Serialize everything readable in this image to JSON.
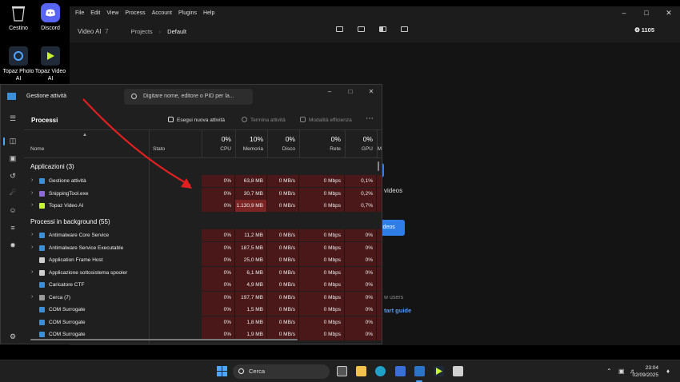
{
  "desktop": {
    "icons": [
      {
        "label": "Cestino",
        "icon": "recycle-bin-icon"
      },
      {
        "label": "Discord",
        "icon": "discord-icon"
      },
      {
        "label": "Topaz Photo AI",
        "icon": "topaz-photo-icon"
      },
      {
        "label": "Topaz Video AI",
        "icon": "topaz-video-icon"
      }
    ]
  },
  "video_ai": {
    "menu": [
      "File",
      "Edit",
      "View",
      "Process",
      "Account",
      "Plugins",
      "Help"
    ],
    "brand": "Video AI",
    "version": "7",
    "breadcrumb": [
      "Projects",
      "Default"
    ],
    "credits": "1105",
    "peek": {
      "line1": "videos",
      "button": "ideos",
      "line2": "w users",
      "link": "tart guide"
    },
    "accent": "#2f7ee8"
  },
  "task_manager": {
    "title": "Gestione attività",
    "search_placeholder": "Digitare nome, editore o PID per la...",
    "page_title": "Processi",
    "commands": {
      "new_task": "Esegui nuova attività",
      "end_task": "Termina attività",
      "efficiency": "Modalità efficienza"
    },
    "columns": {
      "name": "Nome",
      "status": "Stato",
      "cpu": {
        "pct": "0%",
        "label": "CPU"
      },
      "memory": {
        "pct": "10%",
        "label": "Memoria"
      },
      "disk": {
        "pct": "0%",
        "label": "Disco"
      },
      "network": {
        "pct": "0%",
        "label": "Rete"
      },
      "gpu": {
        "pct": "0%",
        "label": "GPU"
      },
      "gpu_engine_stub": "M"
    },
    "group_apps": "Applicazioni (3)",
    "apps": [
      {
        "name": "Gestione attività",
        "cpu": "0%",
        "memory": "63,8 MB",
        "disk": "0 MB/s",
        "network": "0 Mbps",
        "gpu": "0,1%",
        "expandable": true
      },
      {
        "name": "SnippingTool.exe",
        "cpu": "0%",
        "memory": "30,7 MB",
        "disk": "0 MB/s",
        "network": "0 Mbps",
        "gpu": "0,2%",
        "expandable": true
      },
      {
        "name": "Topaz Video AI",
        "cpu": "0%",
        "memory": "1.130,9 MB",
        "disk": "0 MB/s",
        "network": "0 Mbps",
        "gpu": "0,7%",
        "expandable": true
      }
    ],
    "group_background": "Processi in background (55)",
    "background": [
      {
        "name": "Antimalware Core Service",
        "cpu": "0%",
        "memory": "11,2 MB",
        "disk": "0 MB/s",
        "network": "0 Mbps",
        "gpu": "0%",
        "expandable": true
      },
      {
        "name": "Antimalware Service Executable",
        "cpu": "0%",
        "memory": "187,5 MB",
        "disk": "0 MB/s",
        "network": "0 Mbps",
        "gpu": "0%",
        "expandable": true
      },
      {
        "name": "Application Frame Host",
        "cpu": "0%",
        "memory": "25,0 MB",
        "disk": "0 MB/s",
        "network": "0 Mbps",
        "gpu": "0%",
        "expandable": false
      },
      {
        "name": "Applicazione sottosistema spooler",
        "cpu": "0%",
        "memory": "6,1 MB",
        "disk": "0 MB/s",
        "network": "0 Mbps",
        "gpu": "0%",
        "expandable": true
      },
      {
        "name": "Caricatore CTF",
        "cpu": "0%",
        "memory": "4,9 MB",
        "disk": "0 MB/s",
        "network": "0 Mbps",
        "gpu": "0%",
        "expandable": false
      },
      {
        "name": "Cerca (7)",
        "cpu": "0%",
        "memory": "197,7 MB",
        "disk": "0 MB/s",
        "network": "0 Mbps",
        "gpu": "0%",
        "expandable": true
      },
      {
        "name": "COM Surrogate",
        "cpu": "0%",
        "memory": "1,5 MB",
        "disk": "0 MB/s",
        "network": "0 Mbps",
        "gpu": "0%",
        "expandable": false
      },
      {
        "name": "COM Surrogate",
        "cpu": "0%",
        "memory": "1,8 MB",
        "disk": "0 MB/s",
        "network": "0 Mbps",
        "gpu": "0%",
        "expandable": false
      },
      {
        "name": "COM Surrogate",
        "cpu": "0%",
        "memory": "1,9 MB",
        "disk": "0 MB/s",
        "network": "0 Mbps",
        "gpu": "0%",
        "expandable": false
      }
    ],
    "heat_color": "#4a1818",
    "hot_color": "#7a2424"
  },
  "annotation": {
    "arrow_color": "#e02020"
  },
  "taskbar": {
    "search_label": "Cerca",
    "time": "23:04",
    "date": "02/09/2025"
  }
}
